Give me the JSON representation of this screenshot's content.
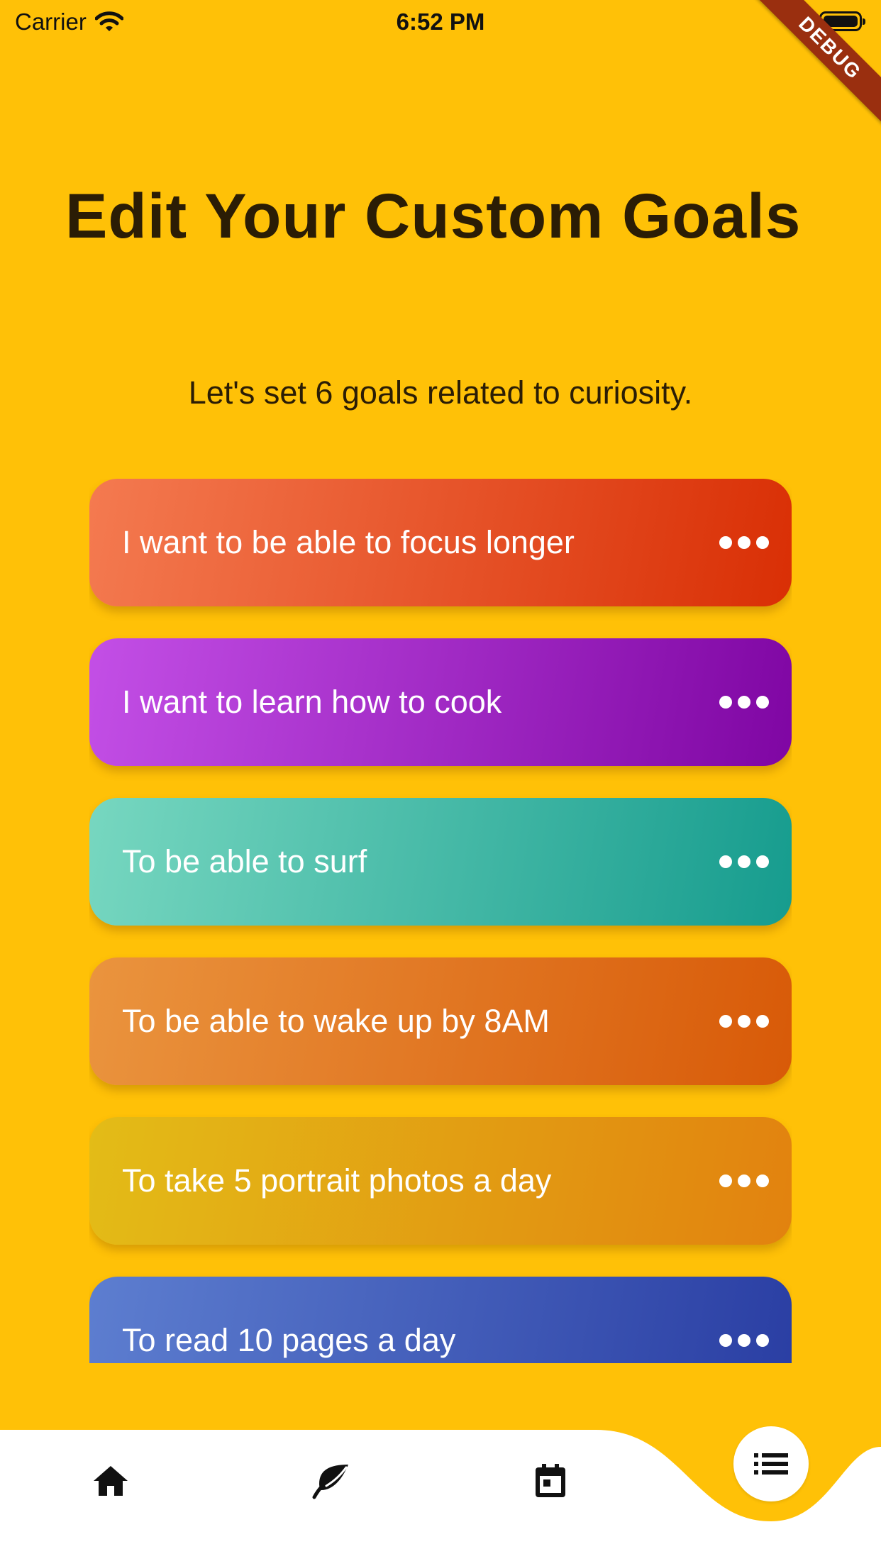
{
  "status_bar": {
    "carrier": "Carrier",
    "time": "6:52 PM"
  },
  "debug_banner": "DEBUG",
  "page": {
    "title": "Edit Your Custom Goals",
    "subtitle": "Let's set 6 goals related to curiosity."
  },
  "goals": [
    {
      "text": "I want to be able to focus longer",
      "gradient": [
        "#F47A50",
        "#D92F05"
      ]
    },
    {
      "text": "I want to learn how to cook",
      "gradient": [
        "#C34FE6",
        "#7F06A3"
      ]
    },
    {
      "text": "To be able to surf",
      "gradient": [
        "#77D7C0",
        "#169C8E"
      ]
    },
    {
      "text": "To be able to wake up by 8AM",
      "gradient": [
        "#EA943E",
        "#D85A08"
      ]
    },
    {
      "text": "To take 5 portrait photos a day",
      "gradient": [
        "#E3BC17",
        "#E2820F"
      ]
    },
    {
      "text": "To read 10 pages a day",
      "gradient": [
        "#5D7ED0",
        "#2A3EA3"
      ]
    }
  ],
  "bottom_nav": {
    "items": [
      "home-icon",
      "leaf-icon",
      "calendar-icon"
    ],
    "fab_icon": "list-icon"
  },
  "colors": {
    "background": "#FFC107",
    "title_text": "#2B1D05",
    "nav_bar": "#FFFFFF"
  }
}
